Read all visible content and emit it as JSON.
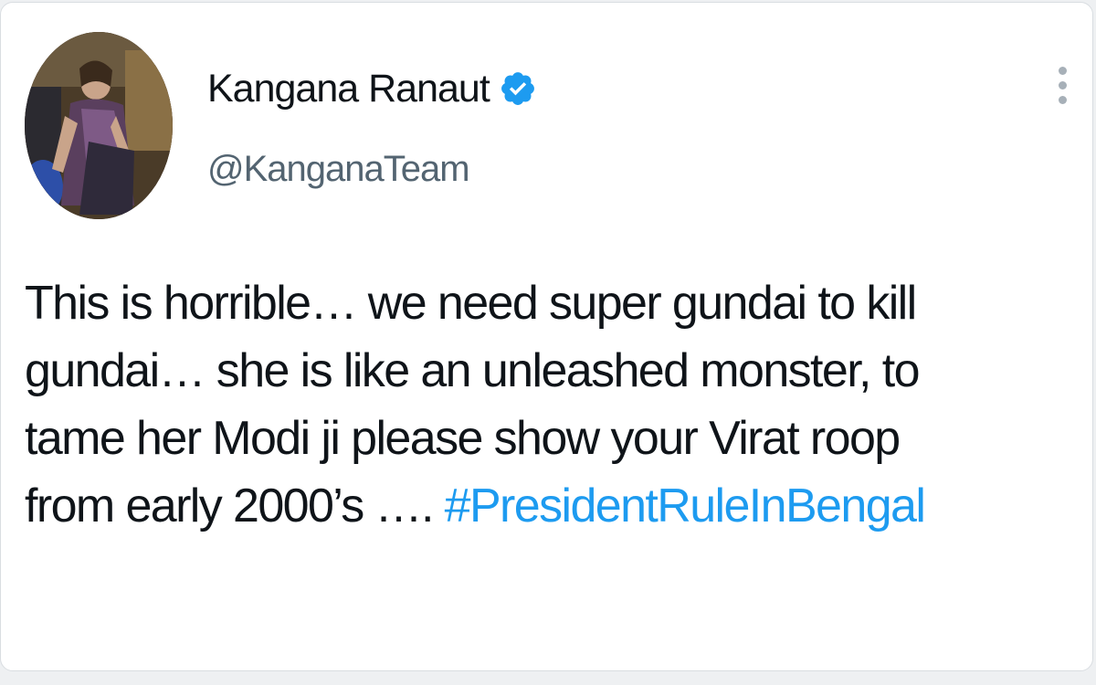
{
  "tweet": {
    "author": {
      "display_name": "Kangana Ranaut",
      "handle": "@KanganaTeam",
      "verified": true,
      "avatar_icon": "profile-photo"
    },
    "more_icon": "more-vertical-icon",
    "text_lines": [
      "This is horrible… we need super gundai to kill",
      "gundai… she is like an unleashed monster, to",
      "tame her Modi ji please show your Virat roop",
      "from early 2000’s …."
    ],
    "hashtag": "#PresidentRuleInBengal",
    "colors": {
      "text": "#0f1419",
      "secondary": "#536471",
      "link": "#1d9bf0",
      "verified": "#1d9bf0"
    }
  }
}
